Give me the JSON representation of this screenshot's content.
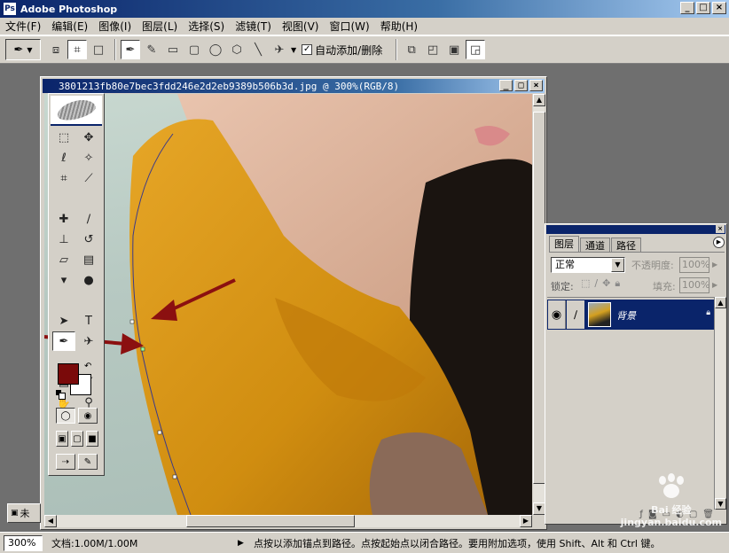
{
  "app": {
    "title": "Adobe Photoshop",
    "window_buttons": [
      "_",
      "□",
      "×"
    ]
  },
  "menu": [
    "文件(F)",
    "编辑(E)",
    "图像(I)",
    "图层(L)",
    "选择(S)",
    "滤镜(T)",
    "视图(V)",
    "窗口(W)",
    "帮助(H)"
  ],
  "options_bar": {
    "auto_add_delete_checked": "✓",
    "auto_add_delete_label": "自动添加/删除"
  },
  "document": {
    "title": "3801213fb80e7bec3fdd246e2d2eb9389b506b3d.jpg @ 300%(RGB/8)",
    "minimized_label": "未"
  },
  "colors": {
    "foreground": "#7a0a0a",
    "background": "#ffffff",
    "annotation_arrow": "#8b1010",
    "selection_highlight": "#0a246a"
  },
  "layers_panel": {
    "tabs": [
      "图层",
      "通道",
      "路径"
    ],
    "blend_mode": "正常",
    "opacity_label": "不透明度:",
    "opacity_value": "100%",
    "lock_label": "锁定:",
    "fill_label": "填充:",
    "fill_value": "100%",
    "layer_name": "背景"
  },
  "status": {
    "zoom": "300%",
    "doc_info": "文档:1.00M/1.00M",
    "message": "点按以添加锚点到路径。点按起始点以闭合路径。要用附加选项，使用 Shift、Alt 和 Ctrl 键。"
  },
  "watermark": {
    "text": "jingyan.baidu.com",
    "brand": "Bai 经验"
  }
}
